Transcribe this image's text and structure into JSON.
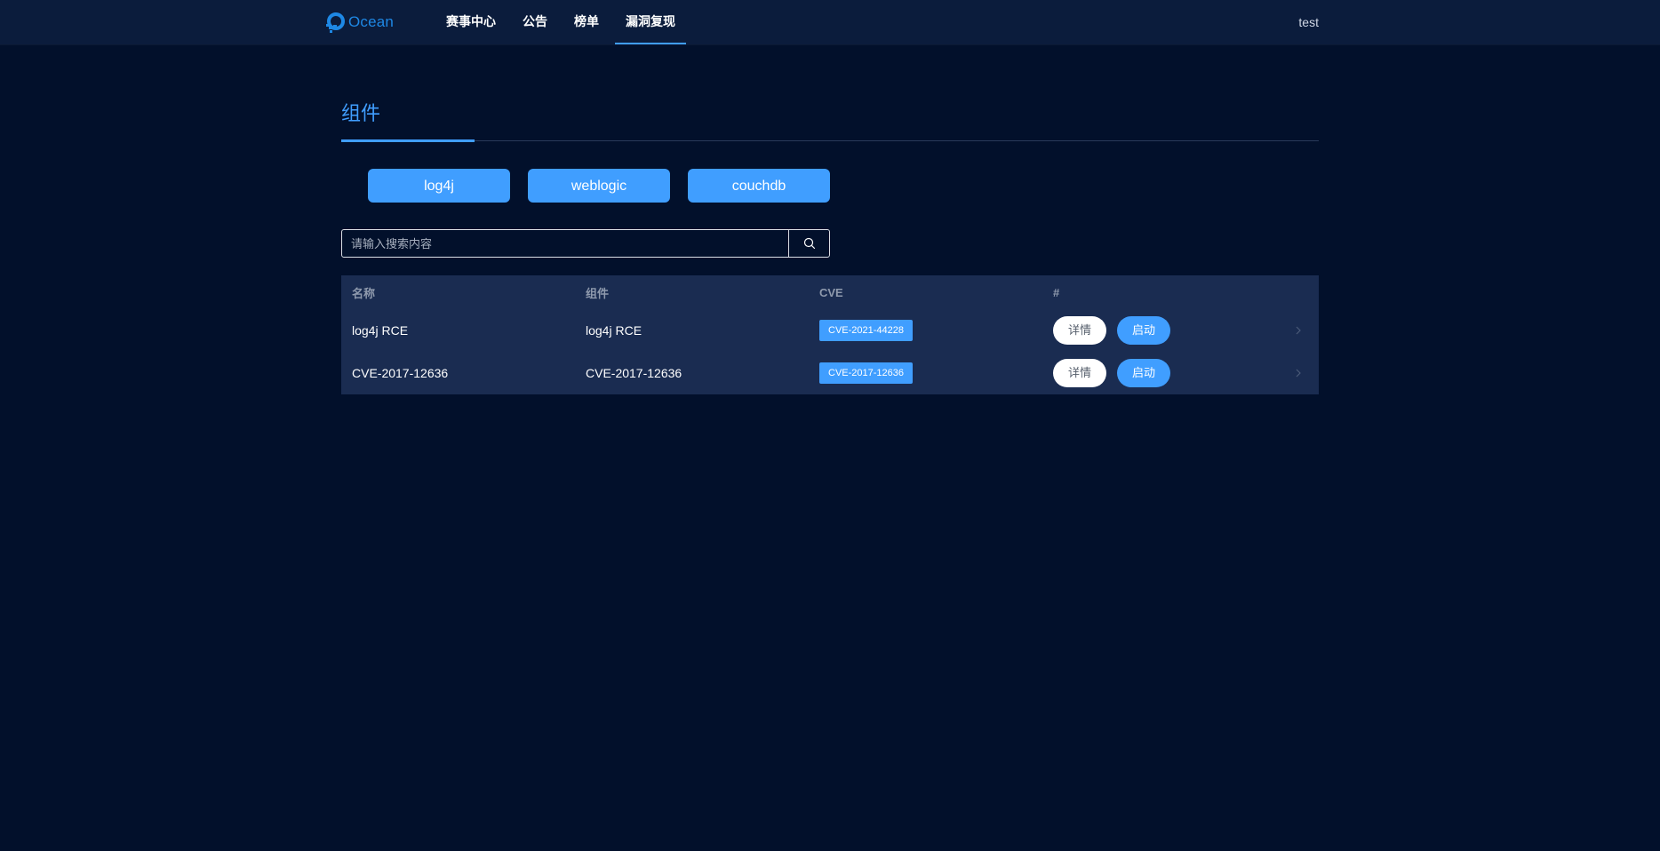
{
  "app": {
    "name": "Ocean",
    "brand_color": "#1e88e5",
    "accent_color": "#409eff",
    "background_color": "#02102b"
  },
  "nav": {
    "items": [
      {
        "label": "赛事中心",
        "active": false
      },
      {
        "label": "公告",
        "active": false
      },
      {
        "label": "榜单",
        "active": false
      },
      {
        "label": "漏洞复现",
        "active": true
      }
    ],
    "user": "test"
  },
  "section": {
    "title": "组件"
  },
  "components": [
    {
      "label": "log4j"
    },
    {
      "label": "weblogic"
    },
    {
      "label": "couchdb"
    }
  ],
  "search": {
    "placeholder": "请输入搜索内容",
    "value": "",
    "icon": "search-icon"
  },
  "table": {
    "headers": [
      "名称",
      "组件",
      "CVE",
      "#"
    ],
    "rows": [
      {
        "name": "log4j RCE",
        "component": "log4j RCE",
        "cve": "CVE-2021-44228",
        "detail_label": "详情",
        "start_label": "启动"
      },
      {
        "name": "CVE-2017-12636",
        "component": "CVE-2017-12636",
        "cve": "CVE-2017-12636",
        "detail_label": "详情",
        "start_label": "启动"
      }
    ]
  }
}
